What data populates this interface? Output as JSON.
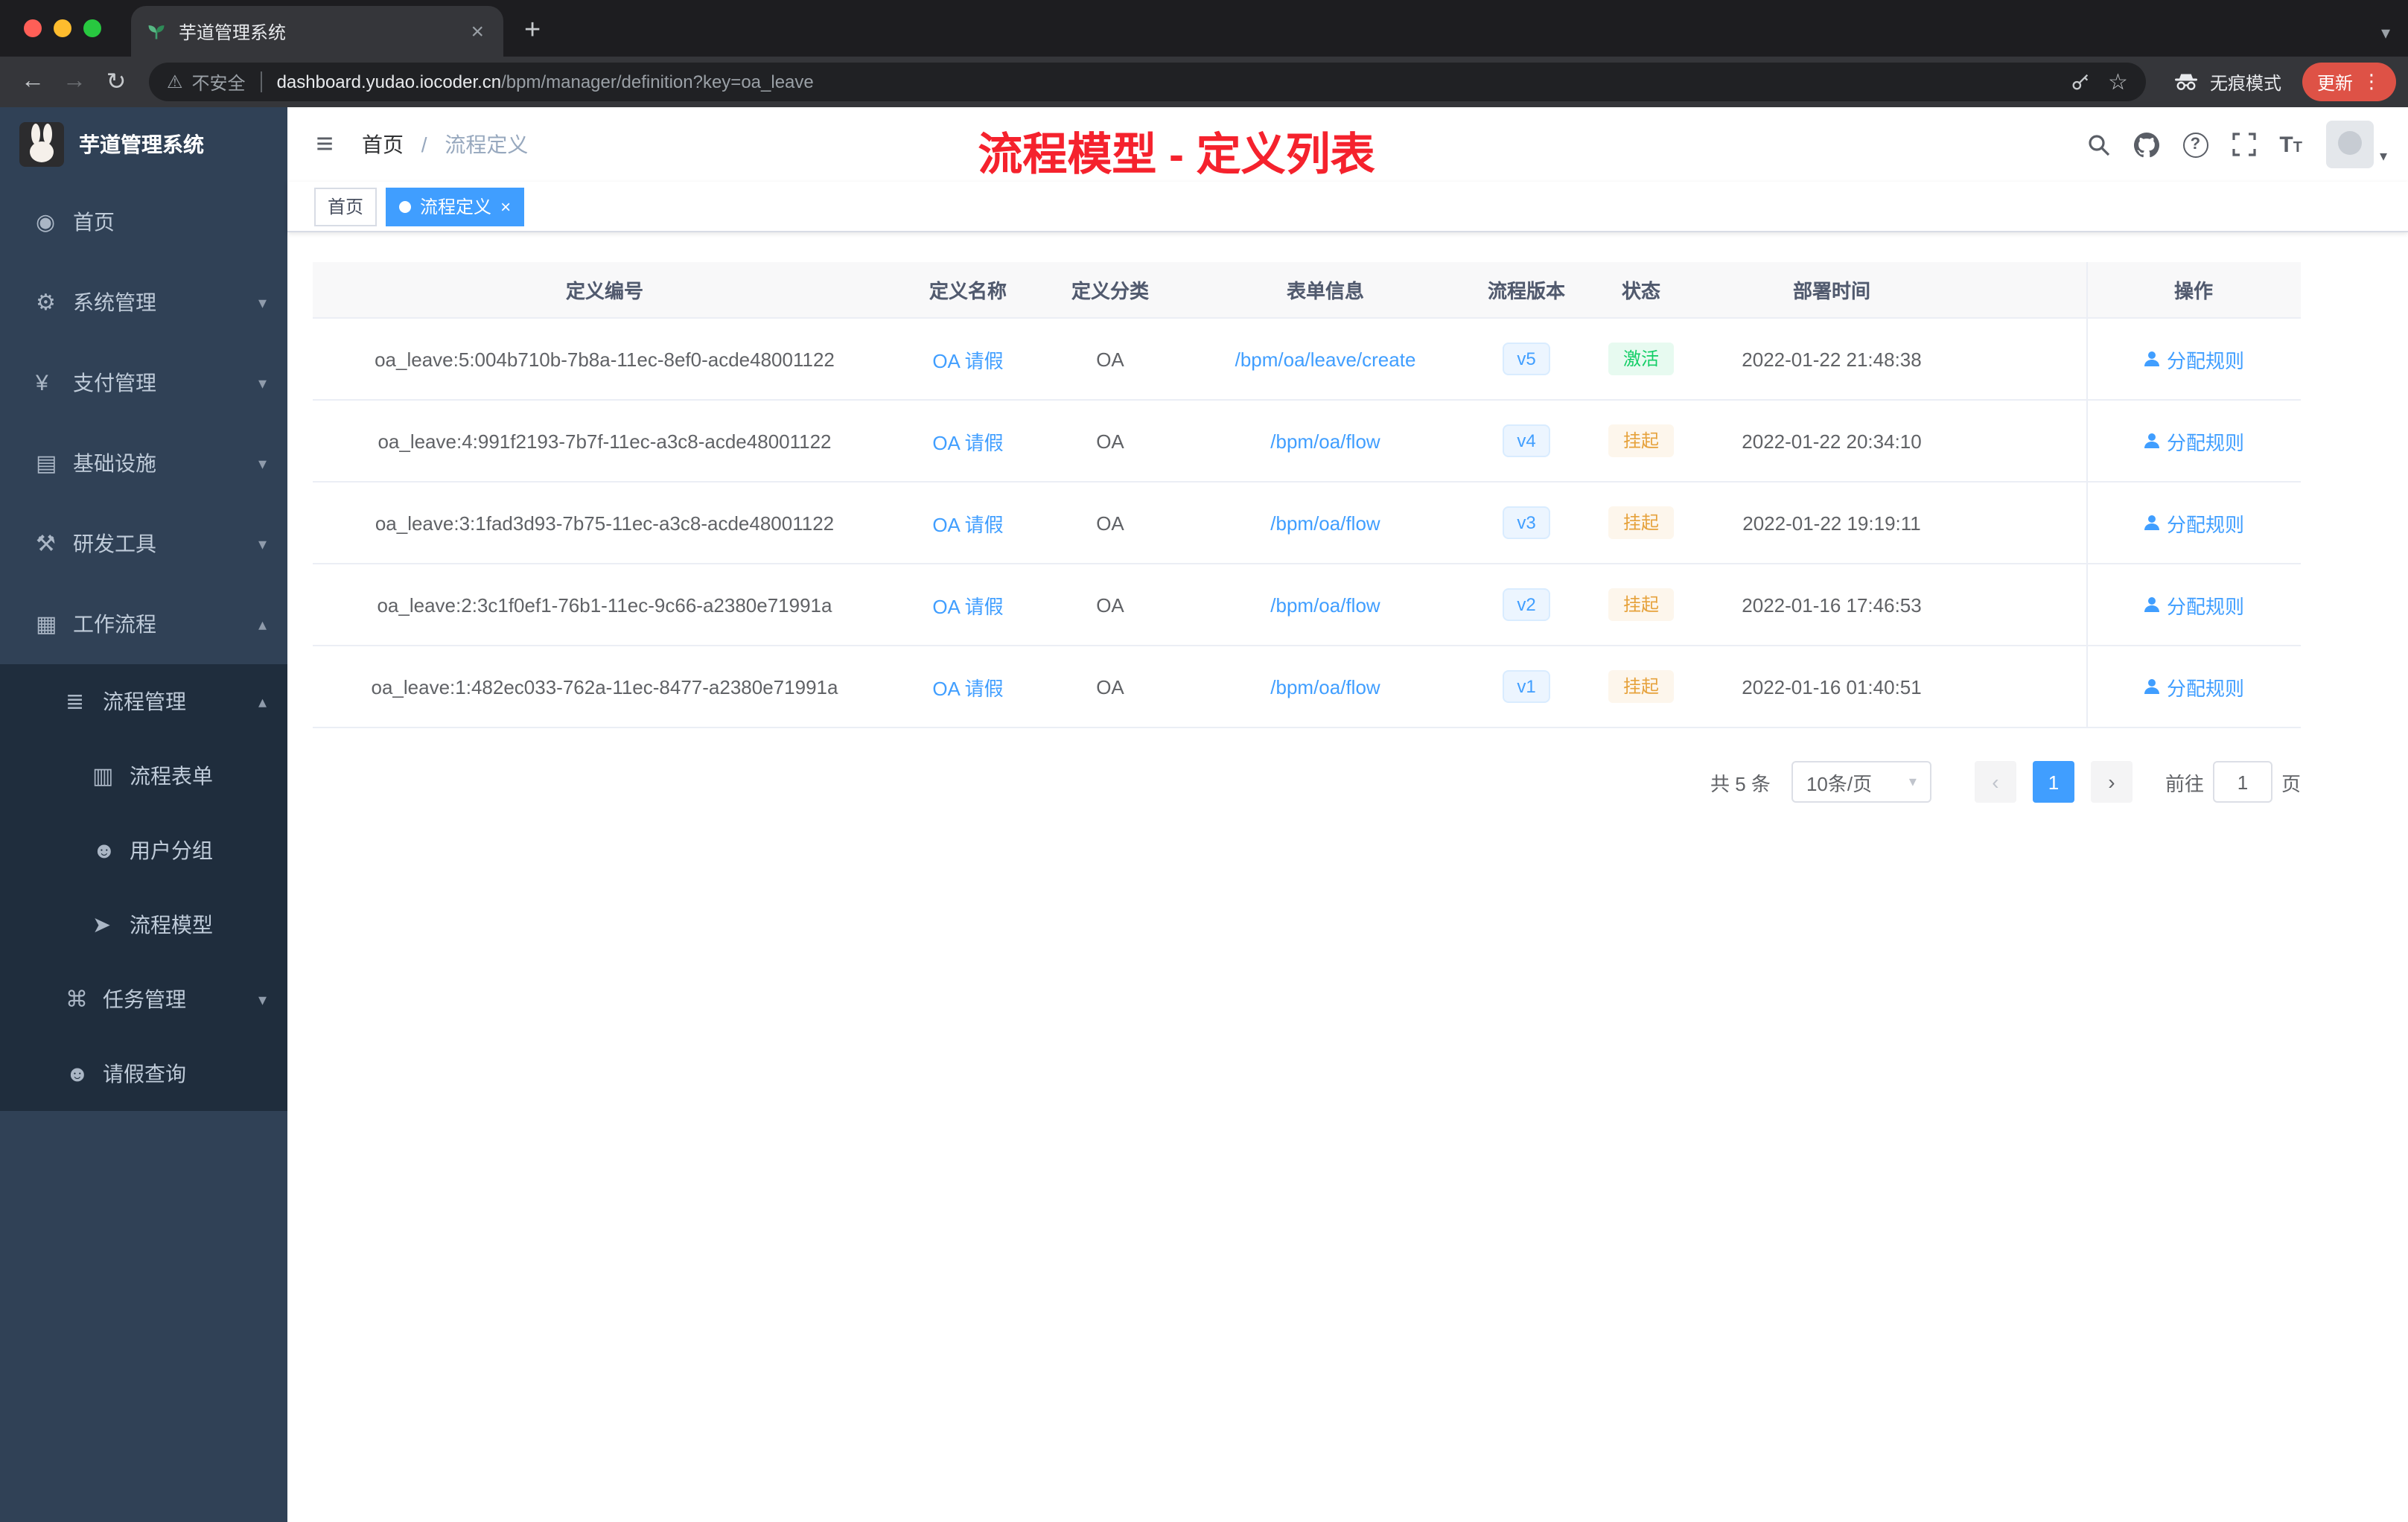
{
  "colors": {
    "accent_blue": "#409eff",
    "success_green": "#13ce66",
    "warning_orange": "#e6a23c",
    "annotation_red": "#f5222d",
    "sidebar_bg": "#304156",
    "sidebar_sub_bg": "#1f2d3d",
    "update_button_red": "#de5246"
  },
  "icons": {
    "hamburger": "≡",
    "chevron_down": "▾",
    "chevron_up": "▴",
    "close": "×",
    "kebab": "⋮",
    "star": "☆",
    "warning": "⚠",
    "back": "←",
    "forward": "→",
    "reload": "↻",
    "help": "?",
    "font_large": "T",
    "font_small": "T",
    "prev": "‹",
    "next": "›"
  },
  "browser": {
    "tab_title": "芋道管理系统",
    "new_tab_button": "+",
    "security_label": "不安全",
    "url_host": "dashboard.yudao.iocoder.cn",
    "url_path": "/bpm/manager/definition?key=oa_leave",
    "incognito_label": "无痕模式",
    "update_label": "更新"
  },
  "sidebar": {
    "logo_title": "芋道管理系统",
    "items": [
      {
        "label": "首页",
        "icon": "◉"
      },
      {
        "label": "系统管理",
        "icon": "⚙"
      },
      {
        "label": "支付管理",
        "icon": "¥"
      },
      {
        "label": "基础设施",
        "icon": "▤"
      },
      {
        "label": "研发工具",
        "icon": "⚒"
      },
      {
        "label": "工作流程",
        "icon": "▦"
      },
      {
        "label": "流程管理",
        "icon": "≣"
      },
      {
        "label": "流程表单",
        "icon": "▥"
      },
      {
        "label": "用户分组",
        "icon": "☻"
      },
      {
        "label": "流程模型",
        "icon": "➤"
      },
      {
        "label": "任务管理",
        "icon": "⌘"
      },
      {
        "label": "请假查询",
        "icon": "☻"
      }
    ]
  },
  "navbar": {
    "breadcrumb_home": "首页",
    "breadcrumb_separator": "/",
    "breadcrumb_current": "流程定义",
    "annotation": "流程模型 - 定义列表"
  },
  "tags": {
    "home": "首页",
    "active": "流程定义"
  },
  "table": {
    "columns": [
      "定义编号",
      "定义名称",
      "定义分类",
      "表单信息",
      "流程版本",
      "状态",
      "部署时间",
      "操作"
    ],
    "rows": [
      {
        "id": "oa_leave:5:004b710b-7b8a-11ec-8ef0-acde48001122",
        "name": "OA 请假",
        "category": "OA",
        "form": "/bpm/oa/leave/create",
        "version": "v5",
        "status": "激活",
        "status_type": "success",
        "time": "2022-01-22 21:48:38",
        "action": "分配规则"
      },
      {
        "id": "oa_leave:4:991f2193-7b7f-11ec-a3c8-acde48001122",
        "name": "OA 请假",
        "category": "OA",
        "form": "/bpm/oa/flow",
        "version": "v4",
        "status": "挂起",
        "status_type": "warning",
        "time": "2022-01-22 20:34:10",
        "action": "分配规则"
      },
      {
        "id": "oa_leave:3:1fad3d93-7b75-11ec-a3c8-acde48001122",
        "name": "OA 请假",
        "category": "OA",
        "form": "/bpm/oa/flow",
        "version": "v3",
        "status": "挂起",
        "status_type": "warning",
        "time": "2022-01-22 19:19:11",
        "action": "分配规则"
      },
      {
        "id": "oa_leave:2:3c1f0ef1-76b1-11ec-9c66-a2380e71991a",
        "name": "OA 请假",
        "category": "OA",
        "form": "/bpm/oa/flow",
        "version": "v2",
        "status": "挂起",
        "status_type": "warning",
        "time": "2022-01-16 17:46:53",
        "action": "分配规则"
      },
      {
        "id": "oa_leave:1:482ec033-762a-11ec-8477-a2380e71991a",
        "name": "OA 请假",
        "category": "OA",
        "form": "/bpm/oa/flow",
        "version": "v1",
        "status": "挂起",
        "status_type": "warning",
        "time": "2022-01-16 01:40:51",
        "action": "分配规则"
      }
    ]
  },
  "pagination": {
    "total_label": "共 5 条",
    "page_size": "10条/页",
    "current_page": "1",
    "goto_label": "前往",
    "goto_value": "1",
    "page_unit": "页"
  }
}
